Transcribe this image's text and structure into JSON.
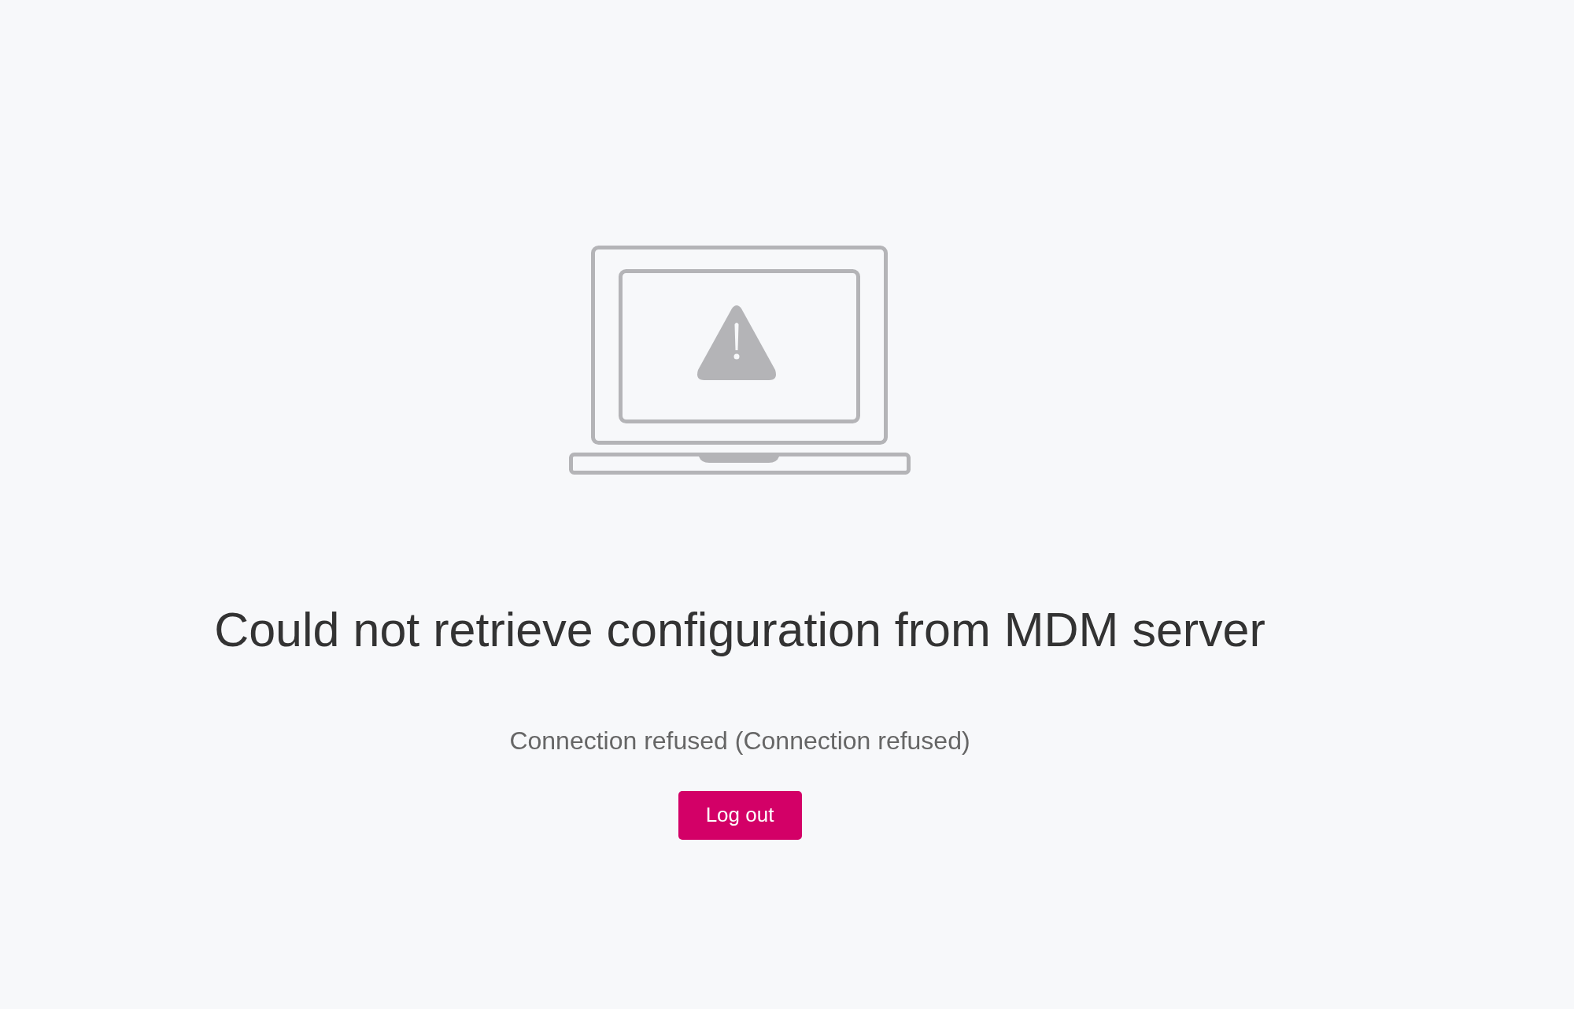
{
  "error": {
    "title": "Could not retrieve configuration from MDM server",
    "message": "Connection refused (Connection refused)"
  },
  "actions": [
    {
      "label": "Log out",
      "kind": "primary"
    }
  ]
}
